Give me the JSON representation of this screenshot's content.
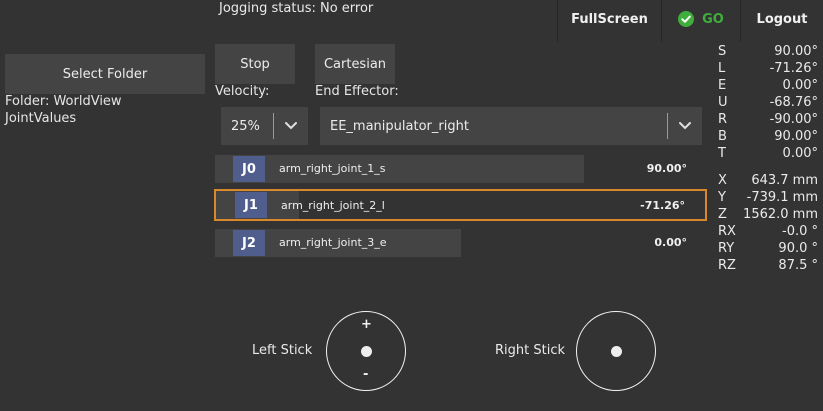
{
  "header": {
    "jog_status": "Jogging status: No error",
    "fullscreen_label": "FullScreen",
    "go_label": "GO",
    "logout_label": "Logout",
    "accent_green": "#3fae3c"
  },
  "sidebar": {
    "select_folder_label": "Select Folder",
    "folder_line": "Folder: WorldView",
    "values_line": "JointValues"
  },
  "toolbar": {
    "stop_label": "Stop",
    "cartesian_label": "Cartesian",
    "velocity_label": "Velocity:",
    "velocity_value": "25%",
    "end_effector_label": "End Effector:",
    "end_effector_value": "EE_manipulator_right"
  },
  "joints": [
    {
      "badge": "J0",
      "name": "arm_right_joint_1_s",
      "value": "90.00°",
      "fill": 0.75,
      "selected": false
    },
    {
      "badge": "J1",
      "name": "arm_right_joint_2_l",
      "value": "-71.26°",
      "fill": 0.17,
      "selected": true
    },
    {
      "badge": "J2",
      "name": "arm_right_joint_3_e",
      "value": "0.00°",
      "fill": 0.5,
      "selected": false
    }
  ],
  "joint_status": [
    {
      "label": "S",
      "value": "90.00°"
    },
    {
      "label": "L",
      "value": "-71.26°"
    },
    {
      "label": "E",
      "value": "0.00°"
    },
    {
      "label": "U",
      "value": "-68.76°"
    },
    {
      "label": "R",
      "value": "-90.00°"
    },
    {
      "label": "B",
      "value": "90.00°"
    },
    {
      "label": "T",
      "value": "0.00°"
    }
  ],
  "pose_status": [
    {
      "label": "X",
      "value": "643.7 mm"
    },
    {
      "label": "Y",
      "value": "-739.1 mm"
    },
    {
      "label": "Z",
      "value": "1562.0 mm"
    },
    {
      "label": "RX",
      "value": "-0.0 °"
    },
    {
      "label": "RY",
      "value": "90.0 °"
    },
    {
      "label": "RZ",
      "value": "87.5 °"
    }
  ],
  "sticks": {
    "left_label": "Left Stick",
    "right_label": "Right Stick",
    "plus": "+",
    "minus": "-"
  }
}
